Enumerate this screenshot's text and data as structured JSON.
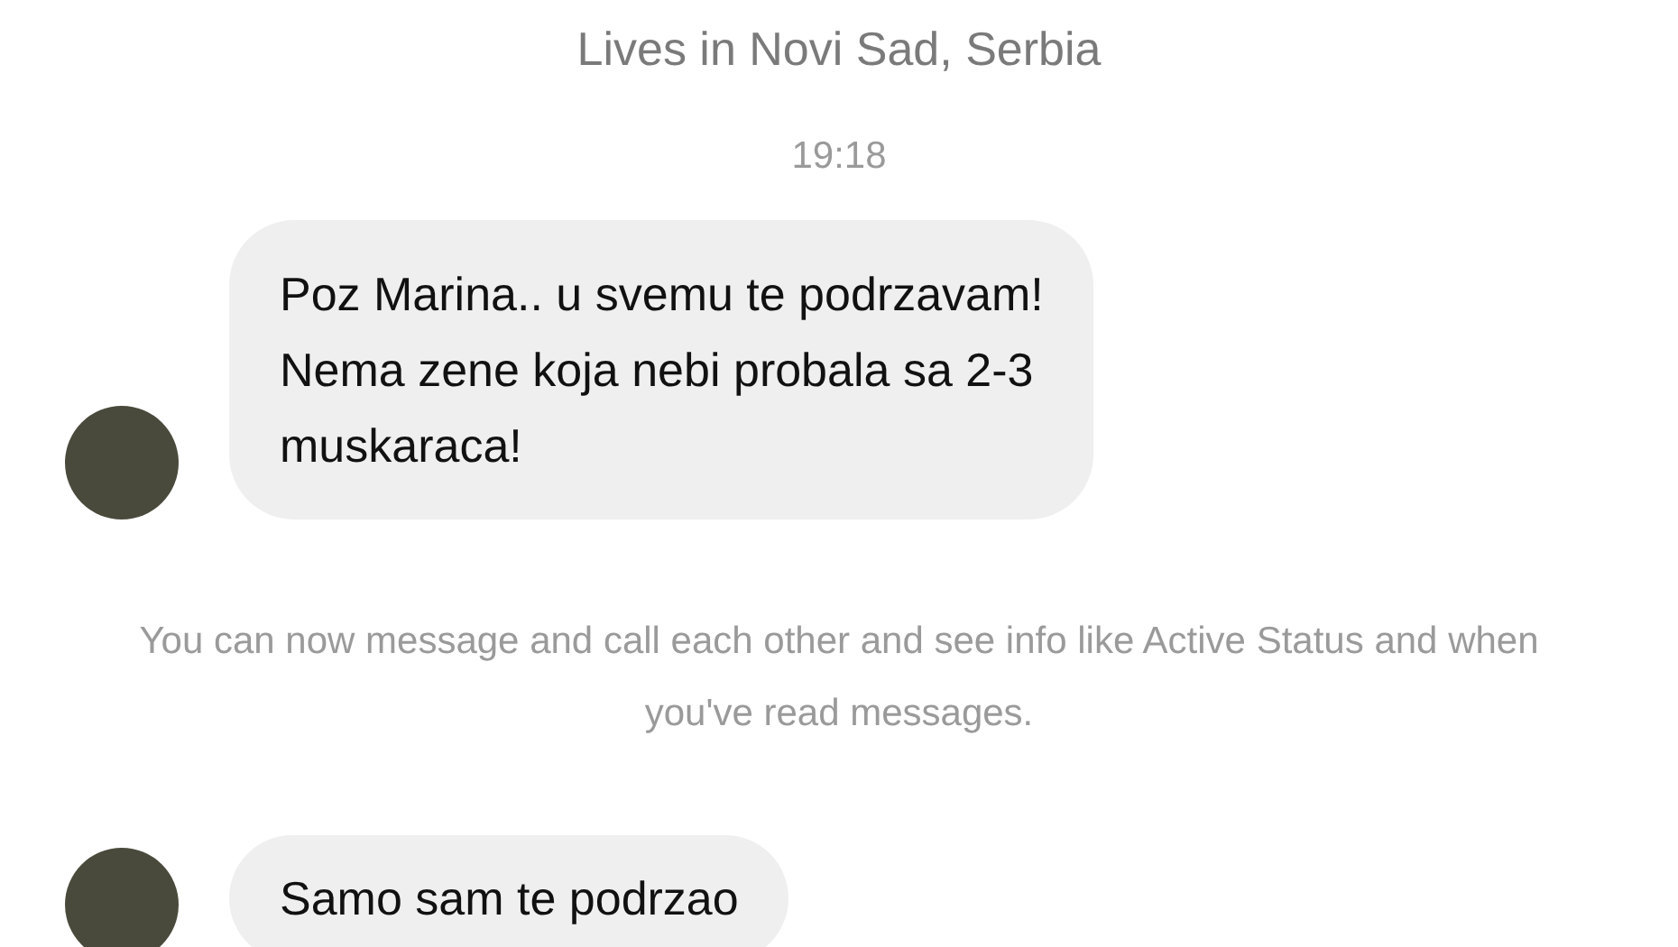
{
  "profile": {
    "location": "Lives in Novi Sad, Serbia"
  },
  "timestamp": "19:18",
  "items": [
    {
      "kind": "message",
      "lines": [
        "Poz Marina.. u svemu te podrzavam!",
        "Nema zene koja nebi probala sa 2-3",
        "muskaraca!"
      ]
    },
    {
      "kind": "notice",
      "text": "You can now message and call each other and see info like Active Status and when you've read messages."
    },
    {
      "kind": "message",
      "lines": [
        "Samo sam te podrzao"
      ]
    }
  ]
}
